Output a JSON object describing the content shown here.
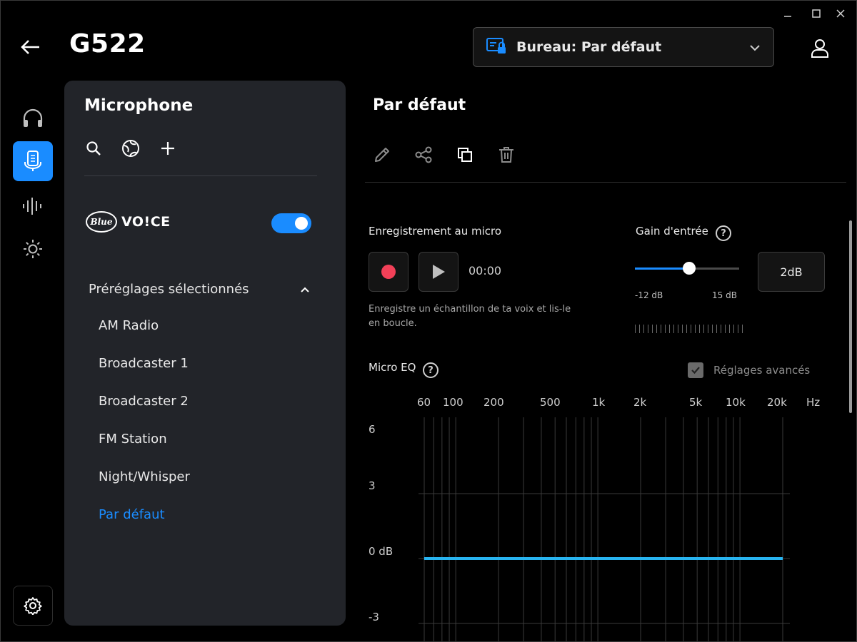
{
  "header": {
    "device": "G522",
    "profile": "Bureau: Par défaut"
  },
  "sidebar": {
    "title": "Microphone",
    "brand": {
      "logo": "Blue",
      "text": "VO!CE"
    },
    "blue_voice_enabled": true,
    "presets_header": "Préréglages sélectionnés",
    "presets": [
      {
        "label": "AM Radio"
      },
      {
        "label": "Broadcaster 1"
      },
      {
        "label": "Broadcaster 2"
      },
      {
        "label": "FM Station"
      },
      {
        "label": "Night/Whisper"
      },
      {
        "label": "Par défaut",
        "selected": true
      }
    ]
  },
  "content": {
    "title": "Par défaut",
    "recording": {
      "label": "Enregistrement au micro",
      "time": "00:00",
      "description": "Enregistre un échantillon de ta voix et lis-le en boucle."
    },
    "gain": {
      "label": "Gain d'entrée",
      "min_label": "-12 dB",
      "max_label": "15 dB",
      "value": "2dB",
      "value_db": 2,
      "min_db": -12,
      "max_db": 15
    },
    "eq": {
      "label": "Micro EQ",
      "advanced_label": "Réglages avancés",
      "advanced_checked": true,
      "freq_labels": [
        "60",
        "100",
        "200",
        "500",
        "1k",
        "2k",
        "5k",
        "10k",
        "20k",
        "Hz"
      ],
      "db_labels": [
        "6",
        "3",
        "0 dB",
        "-3"
      ],
      "curve_db": 0
    }
  },
  "help_glyph": "?",
  "colors": {
    "accent": "#1a8cff",
    "record": "#f24058",
    "panel": "#222429",
    "eq_line": "#28b4f0"
  }
}
